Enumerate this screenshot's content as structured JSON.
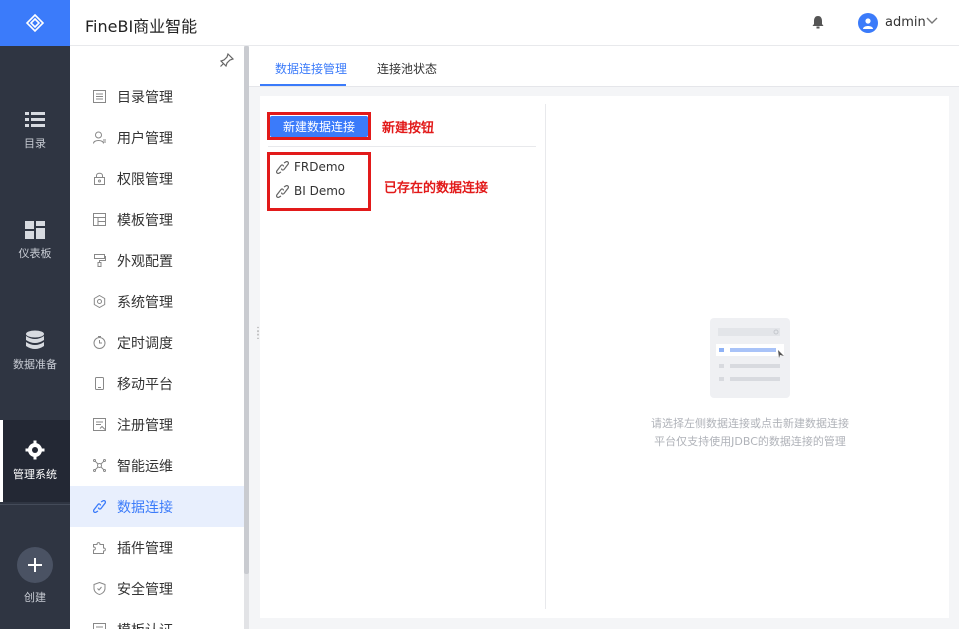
{
  "rail": {
    "items": [
      {
        "label": "目录",
        "icon": "list-icon"
      },
      {
        "label": "仪表板",
        "icon": "dashboard-icon"
      },
      {
        "label": "数据准备",
        "icon": "database-icon"
      },
      {
        "label": "管理系统",
        "icon": "gear-icon"
      }
    ],
    "create_label": "创建"
  },
  "header": {
    "title": "FineBI商业智能",
    "user": "admin"
  },
  "sidebar": {
    "items": [
      {
        "label": "目录管理",
        "icon": "catalog-icon"
      },
      {
        "label": "用户管理",
        "icon": "user-icon"
      },
      {
        "label": "权限管理",
        "icon": "lock-icon"
      },
      {
        "label": "模板管理",
        "icon": "template-icon"
      },
      {
        "label": "外观配置",
        "icon": "paint-icon"
      },
      {
        "label": "系统管理",
        "icon": "settings-icon"
      },
      {
        "label": "定时调度",
        "icon": "timer-icon"
      },
      {
        "label": "移动平台",
        "icon": "mobile-icon"
      },
      {
        "label": "注册管理",
        "icon": "register-icon"
      },
      {
        "label": "智能运维",
        "icon": "ops-icon"
      },
      {
        "label": "数据连接",
        "icon": "link-icon"
      },
      {
        "label": "插件管理",
        "icon": "plugin-icon"
      },
      {
        "label": "安全管理",
        "icon": "shield-icon"
      },
      {
        "label": "模板认证",
        "icon": "certify-icon"
      }
    ],
    "active_index": 10
  },
  "tabs": [
    {
      "label": "数据连接管理"
    },
    {
      "label": "连接池状态"
    }
  ],
  "panel": {
    "new_button": "新建数据连接",
    "annotation_new": "新建按钮",
    "annotation_existing": "已存在的数据连接",
    "connections": [
      "FRDemo",
      "BI Demo"
    ],
    "empty_line1": "请选择左侧数据连接或点击新建数据连接",
    "empty_line2": "平台仅支持使用JDBC的数据连接的管理"
  },
  "colors": {
    "accent": "#3b7bfa",
    "rail_bg": "#2f3542",
    "annotation": "#e21a1a"
  }
}
